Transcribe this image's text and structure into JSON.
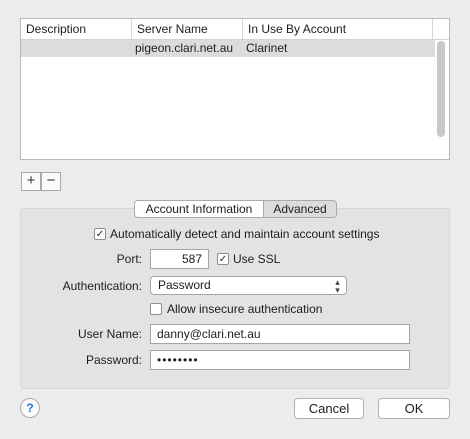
{
  "servers_table": {
    "columns": [
      "Description",
      "Server Name",
      "In Use By Account"
    ],
    "rows": [
      {
        "description": "",
        "server_name": "pigeon.clari.net.au",
        "in_use_by": "Clarinet"
      }
    ]
  },
  "list_controls": {
    "add_label": "+",
    "remove_label": "−"
  },
  "tabs": {
    "account_info": "Account Information",
    "advanced": "Advanced",
    "selected": "Advanced"
  },
  "settings": {
    "auto_detect_label": "Automatically detect and maintain account settings",
    "auto_detect_checked": true,
    "port_label": "Port:",
    "port_value": "587",
    "use_ssl_label": "Use SSL",
    "use_ssl_checked": true,
    "auth_label": "Authentication:",
    "auth_value": "Password",
    "allow_insecure_label": "Allow insecure authentication",
    "allow_insecure_checked": false,
    "username_label": "User Name:",
    "username_value": "danny@clari.net.au",
    "password_label": "Password:",
    "password_value": "••••••••"
  },
  "icons": {
    "check": "✓",
    "help": "?",
    "select_arrows": "⌃⌄"
  },
  "footer": {
    "help_label": "?",
    "cancel_label": "Cancel",
    "ok_label": "OK"
  },
  "colors": {
    "window_bg": "#ececec",
    "selected_row": "#dcdcdc",
    "selected_tab": "#dcdcdc"
  }
}
